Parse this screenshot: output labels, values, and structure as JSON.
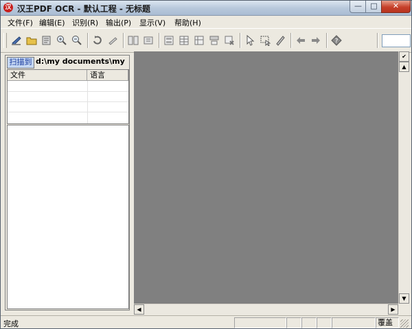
{
  "window": {
    "title": "汉王PDF OCR - 默认工程 - 无标题",
    "min_glyph": "—",
    "max_glyph": "□",
    "close_glyph": "✕"
  },
  "menu": [
    "文件(F)",
    "编辑(E)",
    "识别(R)",
    "输出(P)",
    "显示(V)",
    "帮助(H)"
  ],
  "toolbar": {
    "icons": [
      "scan-icon",
      "open-folder-icon",
      "import-image-icon",
      "zoom-in-icon",
      "zoom-out-icon",
      "rotate-icon",
      "deskew-icon",
      "split-page-icon",
      "merge-page-icon",
      "layout-analysis-icon",
      "recognize-icon",
      "table-icon",
      "clear-icon",
      "delete-icon",
      "select-pointer-icon",
      "region-select-icon",
      "pen-icon",
      "back-arrow-icon",
      "forward-arrow-icon",
      "help-icon"
    ],
    "input_value": ""
  },
  "left_pane": {
    "scan_to_label": "扫描到",
    "scan_path": "d:\\my documents\\my h",
    "columns": [
      "文件",
      "语言"
    ],
    "rows": []
  },
  "status": {
    "text": "完成",
    "mode": "覆盖"
  },
  "colors": {
    "canvas": "#808080",
    "chrome": "#ece9e0",
    "close_button": "#c6402a"
  }
}
